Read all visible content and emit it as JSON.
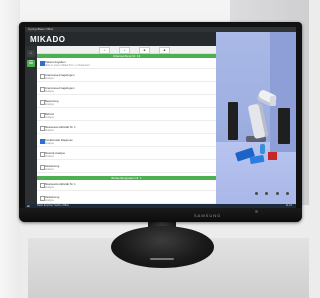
{
  "app": {
    "window_title": "KyokyoBase Office",
    "logo_text": "MIKADO",
    "menu": [
      "Start",
      "Edit",
      "Tools",
      "Tools"
    ],
    "toolbar_buttons": [
      "+",
      "+",
      "■",
      "■"
    ],
    "sidebar_icons": [
      "home-icon",
      "list-icon"
    ],
    "sections": [
      {
        "title": "Untersuchung Nr. 13",
        "rows": [
          {
            "label": "Patient Angaben",
            "sub": "Alles in einem Ablauf Text - in Dokument",
            "checked": true
          },
          {
            "label": "Anamnese-Fragebogen",
            "sub": "Analyse"
          },
          {
            "label": "Anamnese-Fragebogen",
            "sub": "Analyse"
          },
          {
            "label": "Bewertung",
            "sub": "Analyse"
          },
          {
            "label": "Befund",
            "sub": "Analyse"
          },
          {
            "label": "Messwerte Aktivität Nr. 1",
            "sub": "Analyse"
          },
          {
            "label": "Funktionelle Diagnose",
            "sub": "Analyse",
            "checked": true
          },
          {
            "label": "Motorik-Analyse",
            "sub": "Analyse"
          },
          {
            "label": "Zielsetzung",
            "sub": "Analyse"
          }
        ]
      },
      {
        "title": "Behandlungsplan Nr. 1",
        "rows": [
          {
            "label": "Messwerte Aktivität Nr. 1",
            "sub": "Analyse"
          },
          {
            "label": "Zielsetzung",
            "sub": "Analyse"
          },
          {
            "label": "Messwerte Aktivität Nr. 2",
            "sub": "Analyse"
          },
          {
            "label": "Funktionelle Diagnose",
            "sub": "Analyse",
            "checked": true
          }
        ]
      }
    ]
  },
  "taskbar": {
    "start": "⊞",
    "items": "Datei  Explorer  Suche  Office",
    "tray": "11:24"
  },
  "monitor": {
    "brand": "SAMSUNG"
  },
  "colors": {
    "accent": "#4caf50",
    "dark": "#262a2d",
    "viewport_blue": "#9fb0e2"
  }
}
